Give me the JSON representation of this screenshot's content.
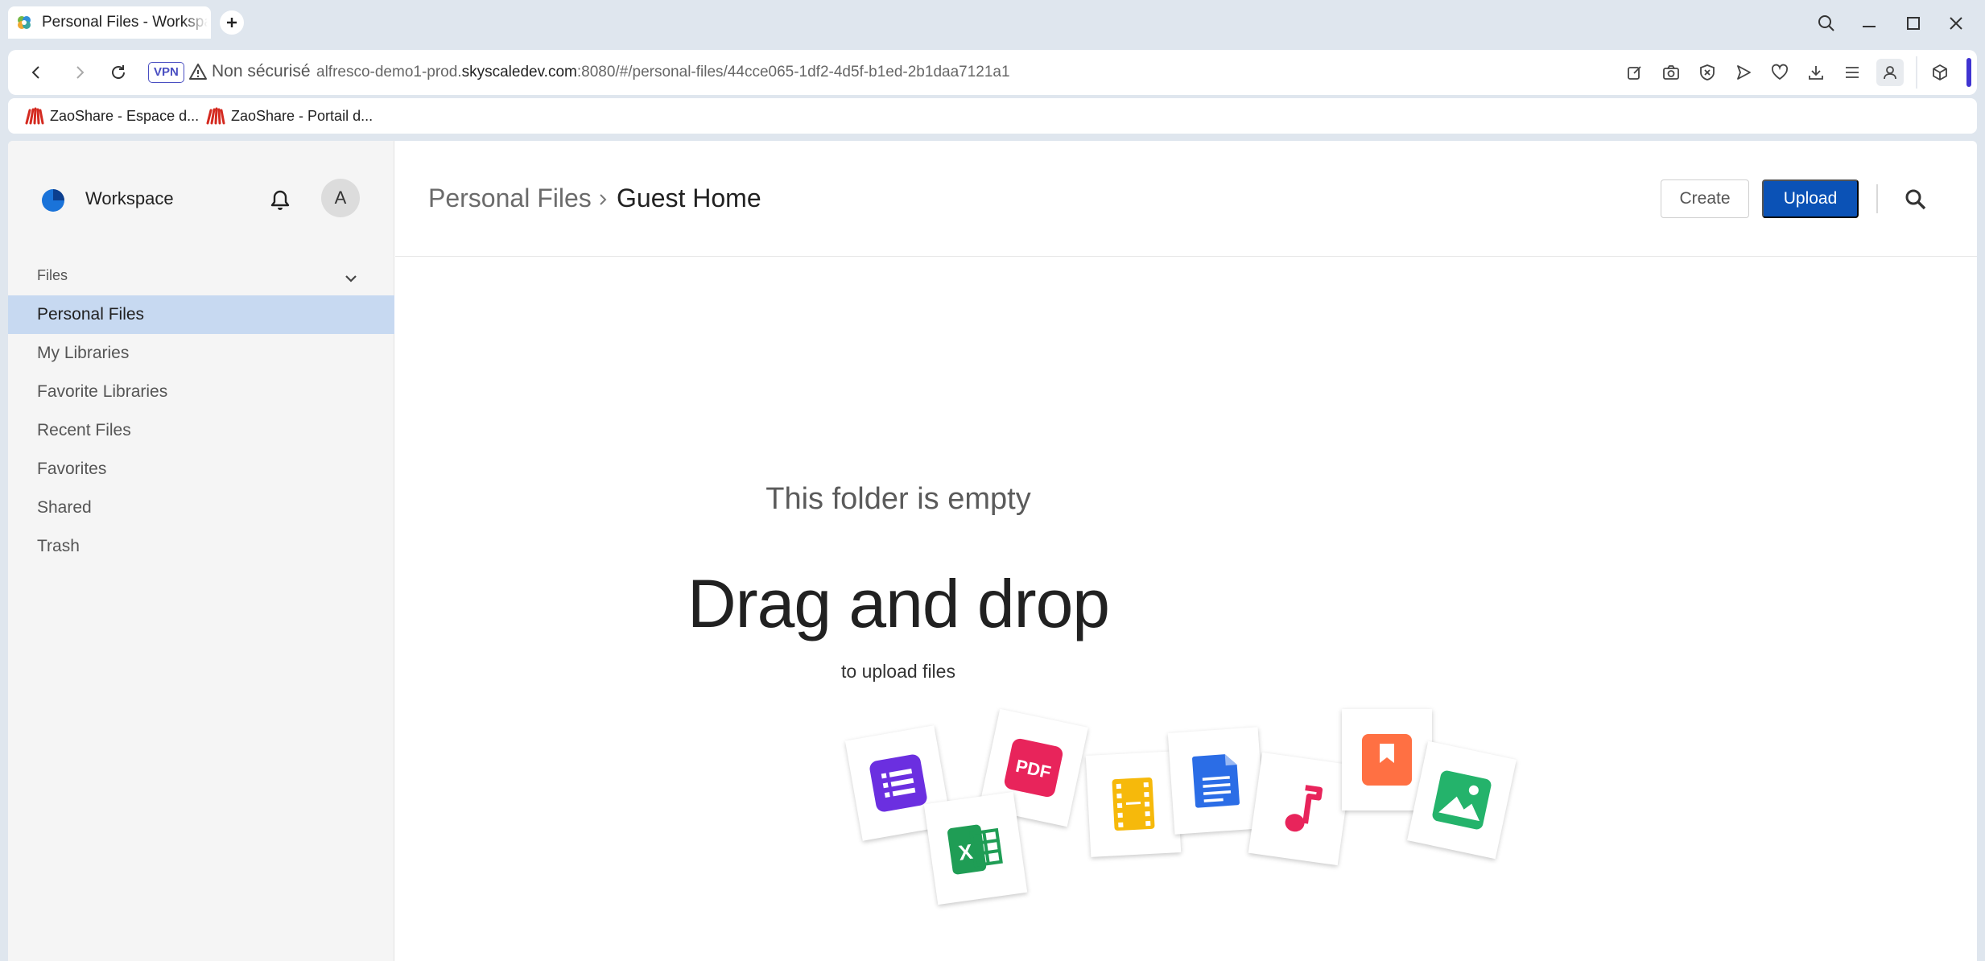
{
  "browser": {
    "tab_title": "Personal Files - Workspace",
    "security": {
      "vpn_label": "VPN",
      "warning_text": "Non sécurisé"
    },
    "url": {
      "prefix": "alfresco-demo1-prod.",
      "domain": "skyscaledev.com",
      "suffix": ":8080/#/personal-files/44cce065-1df2-4d5f-b1ed-2b1daa7121a1"
    },
    "bookmarks": [
      {
        "label": "ZaoShare - Espace d..."
      },
      {
        "label": "ZaoShare - Portail d..."
      }
    ],
    "accent_color": "#3f33d1"
  },
  "app": {
    "brand_name": "Workspace",
    "avatar_initial": "A",
    "files_section_label": "Files",
    "nav_items": [
      {
        "label": "Personal Files",
        "active": true
      },
      {
        "label": "My Libraries",
        "active": false
      },
      {
        "label": "Favorite Libraries",
        "active": false
      },
      {
        "label": "Recent Files",
        "active": false
      },
      {
        "label": "Favorites",
        "active": false
      },
      {
        "label": "Shared",
        "active": false
      },
      {
        "label": "Trash",
        "active": false
      }
    ],
    "breadcrumb": {
      "root": "Personal Files",
      "current": "Guest Home"
    },
    "actions": {
      "create_label": "Create",
      "upload_label": "Upload"
    },
    "empty_state": {
      "title": "This folder is empty",
      "headline": "Drag and drop",
      "subtitle": "to upload files"
    },
    "file_type_icons": [
      "list-document-icon",
      "pdf-icon",
      "spreadsheet-icon",
      "video-icon",
      "text-document-icon",
      "music-icon",
      "ebook-icon",
      "image-icon"
    ],
    "colors": {
      "primary": "#0b52b6",
      "active_nav": "#c7d9f1",
      "sidebar_bg": "#f5f5f5"
    }
  }
}
